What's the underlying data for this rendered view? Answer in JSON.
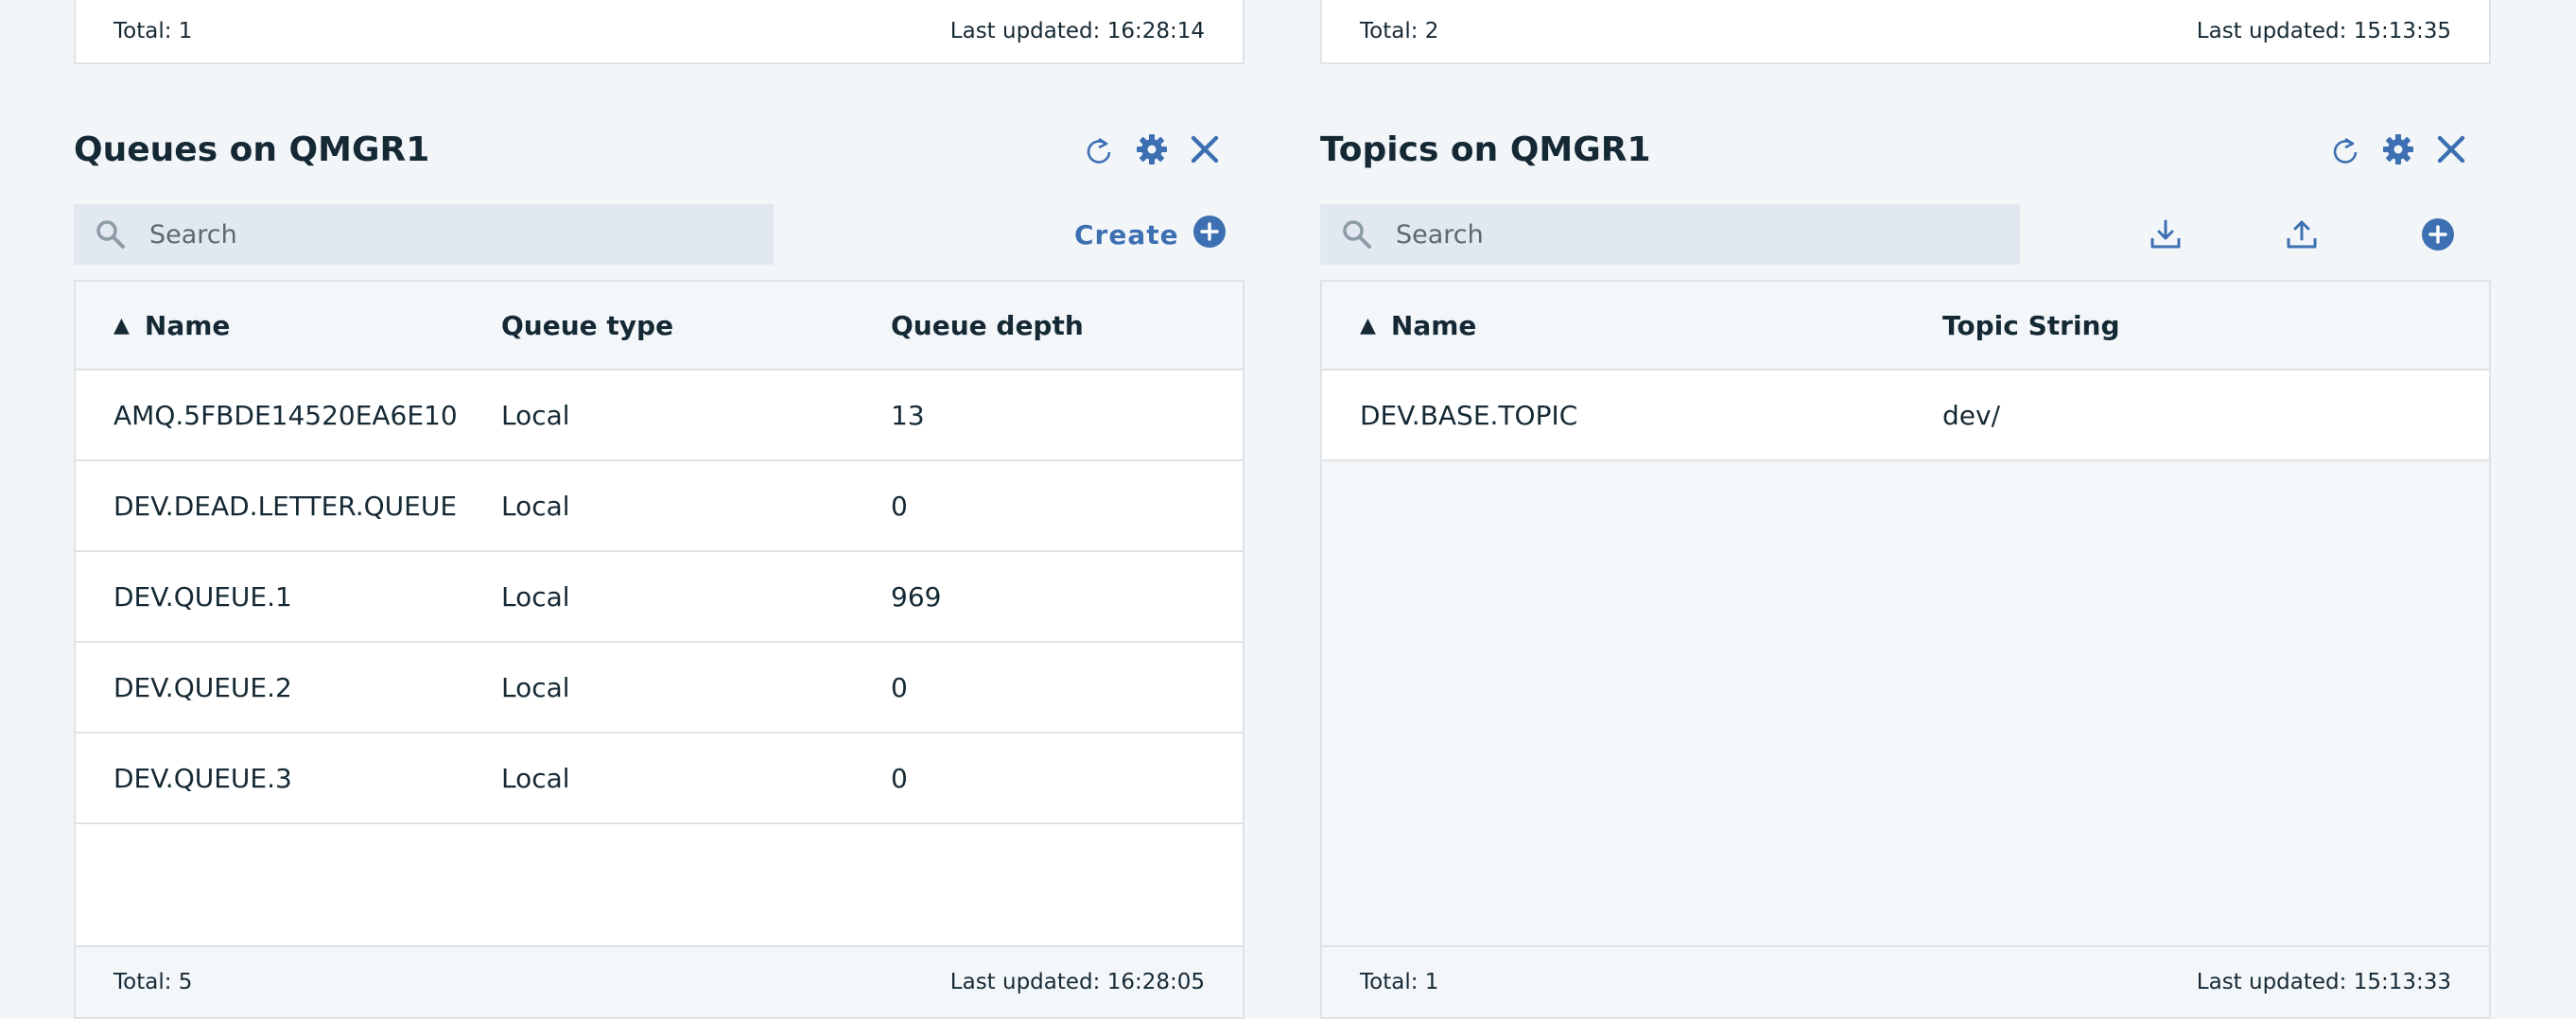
{
  "top_footers": {
    "left": {
      "total": "Total: 1",
      "updated": "Last updated: 16:28:14"
    },
    "right": {
      "total": "Total: 2",
      "updated": "Last updated: 15:13:35"
    }
  },
  "queues": {
    "title": "Queues on QMGR1",
    "search_placeholder": "Search",
    "create_label": "Create",
    "columns": {
      "name": "Name",
      "type": "Queue type",
      "depth": "Queue depth"
    },
    "sort_indicator": "▲",
    "rows": [
      {
        "name": "AMQ.5FBDE14520EA6E10",
        "type": "Local",
        "depth": "13"
      },
      {
        "name": "DEV.DEAD.LETTER.QUEUE",
        "type": "Local",
        "depth": "0"
      },
      {
        "name": "DEV.QUEUE.1",
        "type": "Local",
        "depth": "969"
      },
      {
        "name": "DEV.QUEUE.2",
        "type": "Local",
        "depth": "0"
      },
      {
        "name": "DEV.QUEUE.3",
        "type": "Local",
        "depth": "0"
      }
    ],
    "footer": {
      "total": "Total: 5",
      "updated": "Last updated: 16:28:05"
    }
  },
  "topics": {
    "title": "Topics on QMGR1",
    "search_placeholder": "Search",
    "columns": {
      "name": "Name",
      "topic_string": "Topic String"
    },
    "sort_indicator": "▲",
    "rows": [
      {
        "name": "DEV.BASE.TOPIC",
        "topic_string": "dev/"
      }
    ],
    "footer": {
      "total": "Total: 1",
      "updated": "Last updated: 15:13:33"
    }
  },
  "icons": {
    "refresh": "refresh-icon",
    "settings": "gear-icon",
    "close": "close-icon",
    "search": "search-icon",
    "add": "add-circle-icon",
    "download": "download-icon",
    "upload": "upload-icon"
  },
  "colors": {
    "accent": "#3d70b2",
    "background": "#f3f6f9",
    "search_bg": "#e2e8f0",
    "header_bg": "#f4f7fa"
  }
}
